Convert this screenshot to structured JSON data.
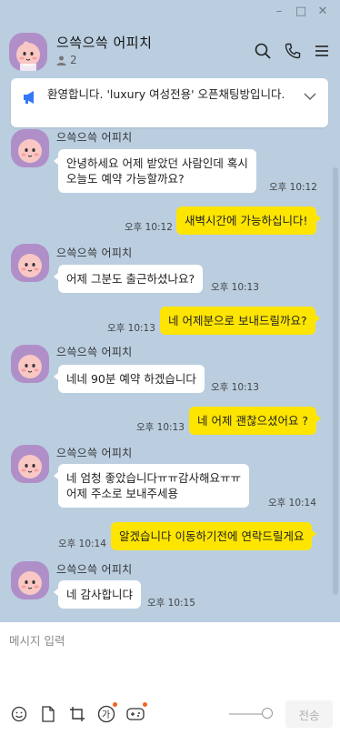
{
  "window": {
    "minimize": "–",
    "maximize": "□",
    "close": "✕"
  },
  "header": {
    "title": "으쓱으쓱 어피치",
    "member_count": "2"
  },
  "notice": {
    "text": "환영합니다. 'luxury 여성전용' 오픈채팅방입니다."
  },
  "messages": [
    {
      "type": "in",
      "sender": "으쓱으쓱 어피치",
      "lines": [
        "안녕하세요 어제 받았던 사람인데 혹시",
        "오늘도 예약 가능할까요?"
      ],
      "time": "오후 10:12"
    },
    {
      "type": "out",
      "text": "새벽시간에 가능하십니다!",
      "time": "오후 10:12"
    },
    {
      "type": "in",
      "sender": "으쓱으쓱 어피치",
      "lines": [
        "어제 그분도 출근하셨나요?"
      ],
      "time": "오후 10:13"
    },
    {
      "type": "out",
      "text": "네 어제분으로 보내드릴까요?",
      "time": "오후 10:13"
    },
    {
      "type": "in",
      "sender": "으쓱으쓱 어피치",
      "lines": [
        "네네 90분 예약 하겠습니다"
      ],
      "time": "오후 10:13"
    },
    {
      "type": "out",
      "text": "네 어제 괜찮으셨어요 ?",
      "time": "오후 10:13"
    },
    {
      "type": "in",
      "sender": "으쓱으쓱 어피치",
      "lines": [
        "네 엄청 좋았습니다ㅠㅠ감사해요ㅠㅠ",
        "어제 주소로 보내주세용"
      ],
      "time": "오후 10:14"
    },
    {
      "type": "out",
      "text": "알겠습니다 이동하기전에 연락드릴게요",
      "time": "오후 10:14"
    },
    {
      "type": "in",
      "sender": "으쓱으쓱 어피치",
      "lines": [
        "네 감사합니댜"
      ],
      "time": "오후 10:15"
    }
  ],
  "input": {
    "placeholder": "메시지 입력"
  },
  "toolbar": {
    "icons": [
      "emoji-icon",
      "file-icon",
      "crop-icon",
      "translate-icon",
      "game-icon"
    ],
    "send_label": "전송"
  },
  "colors": {
    "background": "#bacee0",
    "outgoing_bubble": "#fee500",
    "incoming_bubble": "#ffffff",
    "avatar": "#b08fc9"
  }
}
